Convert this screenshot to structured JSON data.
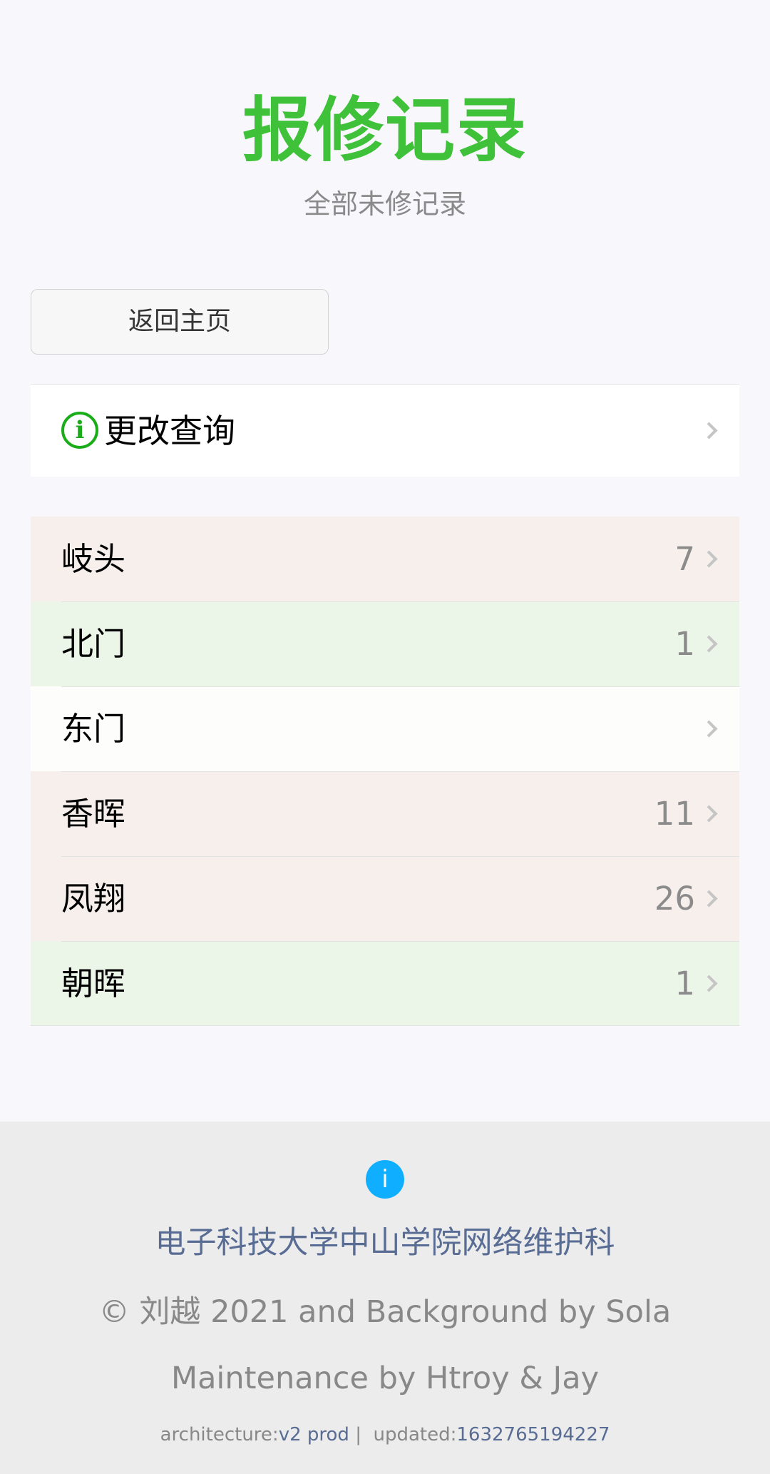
{
  "header": {
    "title": "报修记录",
    "subtitle": "全部未修记录"
  },
  "back_button": {
    "label": "返回主页"
  },
  "query_cell": {
    "icon": "info-circle-icon",
    "label": "更改查询"
  },
  "list": [
    {
      "name": "岐头",
      "count": "7",
      "bg": "#f7efeb"
    },
    {
      "name": "北门",
      "count": "1",
      "bg": "#ecf6e8"
    },
    {
      "name": "东门",
      "count": "",
      "bg": "#fdfdfc"
    },
    {
      "name": "香晖",
      "count": "11",
      "bg": "#f7efeb"
    },
    {
      "name": "凤翔",
      "count": "26",
      "bg": "#f7efeb"
    },
    {
      "name": "朝晖",
      "count": "1",
      "bg": "#ecf6e8"
    }
  ],
  "footer": {
    "icon": "info-icon",
    "org": "电子科技大学中山学院网络维护科",
    "copyright": "© 刘越 2021 and Background by Sola",
    "maintenance": "Maintenance by Htroy & Jay",
    "architecture_label": "architecture:",
    "architecture_value": "v2 prod",
    "separator": "|",
    "updated_label": "updated:",
    "updated_value": "1632765194227"
  },
  "colors": {
    "accent": "#3fc13a",
    "info_icon": "#10aeff",
    "link": "#586c94"
  }
}
